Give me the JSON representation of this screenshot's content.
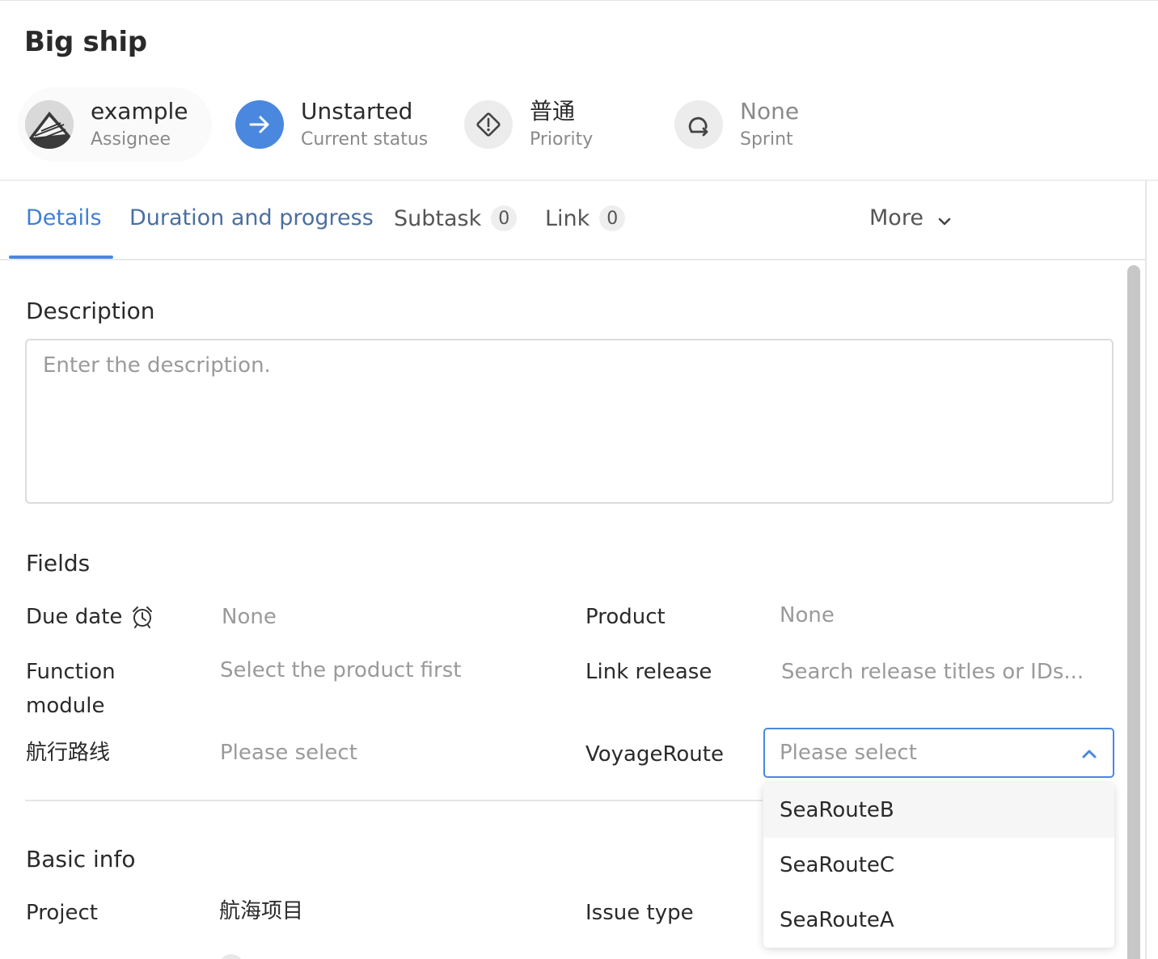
{
  "issue": {
    "title": "Big ship"
  },
  "summary": {
    "assignee": {
      "value": "example",
      "caption": "Assignee"
    },
    "status": {
      "value": "Unstarted",
      "caption": "Current status",
      "color": "#4a88df"
    },
    "priority": {
      "value": "普通",
      "caption": "Priority"
    },
    "sprint": {
      "value": "None",
      "caption": "Sprint"
    }
  },
  "tabs": [
    {
      "label": "Details",
      "active": true
    },
    {
      "label": "Duration and progress"
    },
    {
      "label": "Subtask",
      "count": "0"
    },
    {
      "label": "Link",
      "count": "0"
    },
    {
      "label": "More"
    }
  ],
  "description": {
    "heading": "Description",
    "placeholder": "Enter the description."
  },
  "fields": {
    "heading": "Fields",
    "due_date": {
      "label": "Due date",
      "value": "None"
    },
    "product": {
      "label": "Product",
      "value": "None"
    },
    "function_module": {
      "label_line1": "Function",
      "label_line2": "module",
      "value": "Select the product first"
    },
    "link_release": {
      "label": "Link release",
      "placeholder": "Search release titles or IDs..."
    },
    "route_cn": {
      "label": "航行路线",
      "value": "Please select"
    },
    "voyage_route": {
      "label": "VoyageRoute",
      "placeholder": "Please select",
      "options": [
        "SeaRouteB",
        "SeaRouteC",
        "SeaRouteA"
      ]
    }
  },
  "basic_info": {
    "heading": "Basic info",
    "project": {
      "label": "Project",
      "value": "航海项目"
    },
    "issue_type": {
      "label": "Issue type"
    }
  },
  "colors": {
    "accent": "#4a88df",
    "tab_active": "#3f7fd6"
  }
}
